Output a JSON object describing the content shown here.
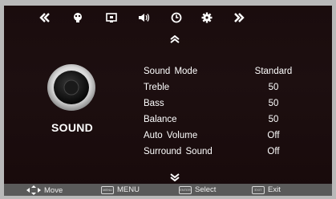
{
  "colors": {
    "background": "#1c0e0f",
    "text": "#ffffff",
    "footer": "#5a5a5a"
  },
  "top_nav": {
    "icons": [
      "chevron-double-left-icon",
      "picture-icon",
      "screen-icon",
      "speaker-icon",
      "clock-icon",
      "gear-icon",
      "chevron-double-right-icon"
    ]
  },
  "section": {
    "title": "SOUND",
    "icon": "speaker-icon"
  },
  "settings": [
    {
      "label": "Sound  Mode",
      "value": "Standard"
    },
    {
      "label": "Treble",
      "value": "50"
    },
    {
      "label": "Bass",
      "value": "50"
    },
    {
      "label": "Balance",
      "value": "50"
    },
    {
      "label": "Auto Volume",
      "value": "Off"
    },
    {
      "label": "Surround Sound",
      "value": "Off"
    }
  ],
  "footer": {
    "move_label": "Move",
    "menu_label": "MENU",
    "select_label": "Select",
    "exit_label": "Exit"
  }
}
